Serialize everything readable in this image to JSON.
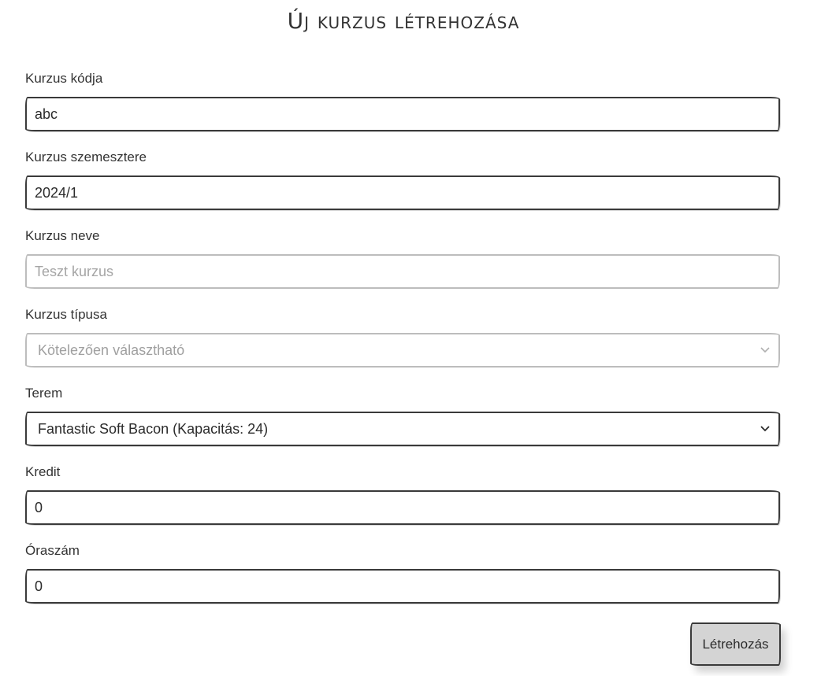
{
  "page": {
    "title": "Új kurzus létrehozása"
  },
  "form": {
    "course_code": {
      "label": "Kurzus kódja",
      "value": "abc"
    },
    "course_semester": {
      "label": "Kurzus szemesztere",
      "value": "2024/1"
    },
    "course_name": {
      "label": "Kurzus neve",
      "placeholder": "Teszt kurzus",
      "value": ""
    },
    "course_type": {
      "label": "Kurzus típusa",
      "selected": "Kötelezően választható"
    },
    "room": {
      "label": "Terem",
      "selected": "Fantastic Soft Bacon (Kapacitás: 24)"
    },
    "credit": {
      "label": "Kredit",
      "value": "0"
    },
    "hours": {
      "label": "Óraszám",
      "value": "0"
    },
    "submit_label": "Létrehozás"
  },
  "icons": {
    "select_chevron": "chevron-down-icon"
  },
  "colors": {
    "border": "#3a3a3a",
    "disabled_border": "#bdbdbd",
    "button_bg": "#d4d4d4"
  }
}
